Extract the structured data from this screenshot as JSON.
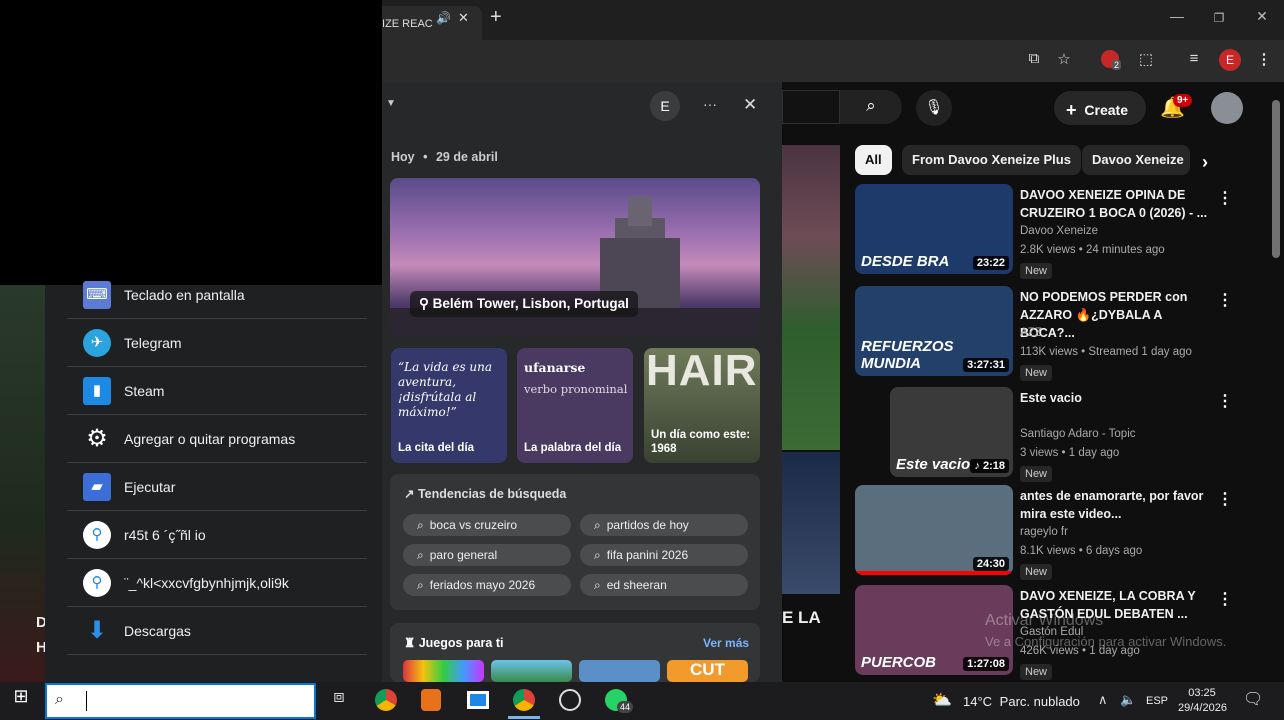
{
  "browser": {
    "active_tab_title": "IZE REAC",
    "new_tab_label": "+",
    "profile_initial": "E",
    "extension_badge": "2"
  },
  "youtube": {
    "create_label": "Create",
    "notif_badge": "9+",
    "chips": [
      "All",
      "From Davoo Xeneize Plus",
      "Davoo Xeneize"
    ],
    "videos": [
      {
        "title": "DAVOO XENEIZE OPINA DE CRUZEIRO 1 BOCA 0 (2026) - ...",
        "channel": "Davoo Xeneize",
        "meta": "2.8K views • 24 minutes ago",
        "badge": "New",
        "duration": "23:22",
        "thumb_text": "DESDE BRA",
        "thumb_color": "#1d3a6b"
      },
      {
        "title": "NO PODEMOS PERDER con AZZARO 🔥¿DYBALA A BOCA?...",
        "channel": "AZZ",
        "meta": "113K views • Streamed 1 day ago",
        "badge": "New",
        "duration": "3:27:31",
        "thumb_text": "REFUERZOS MUNDIA",
        "thumb_color": "#23406b"
      },
      {
        "title": "Este vacio",
        "channel": "Santiago Adaro - Topic",
        "meta": "3 views • 1 day ago",
        "badge": "New",
        "duration": "♪ 2:18",
        "thumb_text": "Este vacio",
        "thumb_color": "#3a3a3a"
      },
      {
        "title": "antes de enamorarte, por favor mira este video...",
        "channel": "rageylo fr",
        "meta": "8.1K views • 6 days ago",
        "badge": "New",
        "duration": "24:30",
        "thumb_text": "",
        "thumb_color": "#5a6e7e"
      },
      {
        "title": "DAVO XENEIZE, LA COBRA Y GASTÓN EDUL DEBATEN ...",
        "channel": "Gastón Edul",
        "meta": "426K views • 1 day ago",
        "badge": "New",
        "duration": "1:27:08",
        "thumb_text": "PUERCOB",
        "thumb_color": "#6a3b5a"
      }
    ],
    "overlay_text": "E LA",
    "left_overlay_text": "D\nH",
    "watermark_line1": "Activar Windows",
    "watermark_line2": "Ve a Configuración para activar Windows."
  },
  "search_panel": {
    "profile_initial": "E",
    "more_label": "···",
    "close_label": "✕",
    "date_label": "Hoy",
    "date_value": "29 de abril",
    "hero_location": "Belém Tower, Lisbon, Portugal",
    "quote_text": "“La vida es una aventura, ¡disfrútala al máximo!”",
    "quote_caption": "La cita del día",
    "word_title": "ufanarse",
    "word_type": "verbo pronominal",
    "word_caption": "La palabra del día",
    "history_image_text": "HAIR",
    "history_caption_line1": "Un día como este:",
    "history_caption_line2": "1968",
    "trends_title": "Tendencias de búsqueda",
    "trends": [
      "boca vs cruzeiro",
      "partidos de hoy",
      "paro general",
      "fifa panini 2026",
      "feriados mayo 2026",
      "ed sheeran"
    ],
    "games_title": "Juegos para ti",
    "games_more": "Ver más",
    "games_tile_text": "CUT"
  },
  "start_menu": {
    "apps": [
      {
        "label": "Teclado en pantalla",
        "icon": "keyboard-icon"
      },
      {
        "label": "Telegram",
        "icon": "telegram-icon"
      },
      {
        "label": "Steam",
        "icon": "steam-icon"
      },
      {
        "label": "Agregar o quitar programas",
        "icon": "gear-icon"
      },
      {
        "label": "Ejecutar",
        "icon": "run-icon"
      },
      {
        "label": "r45t 6 ´ç˝ñl io",
        "icon": "search-icon"
      },
      {
        "label": "¨_^kl<xxcvfgbynhjmjk,oli9k",
        "icon": "search-icon"
      },
      {
        "label": "Descargas",
        "icon": "download-icon"
      }
    ]
  },
  "taskbar": {
    "weather_temp": "14°C",
    "weather_desc": "Parc. nublado",
    "language": "ESP",
    "time": "03:25",
    "date": "29/4/2026",
    "whatsapp_badge": "44"
  }
}
